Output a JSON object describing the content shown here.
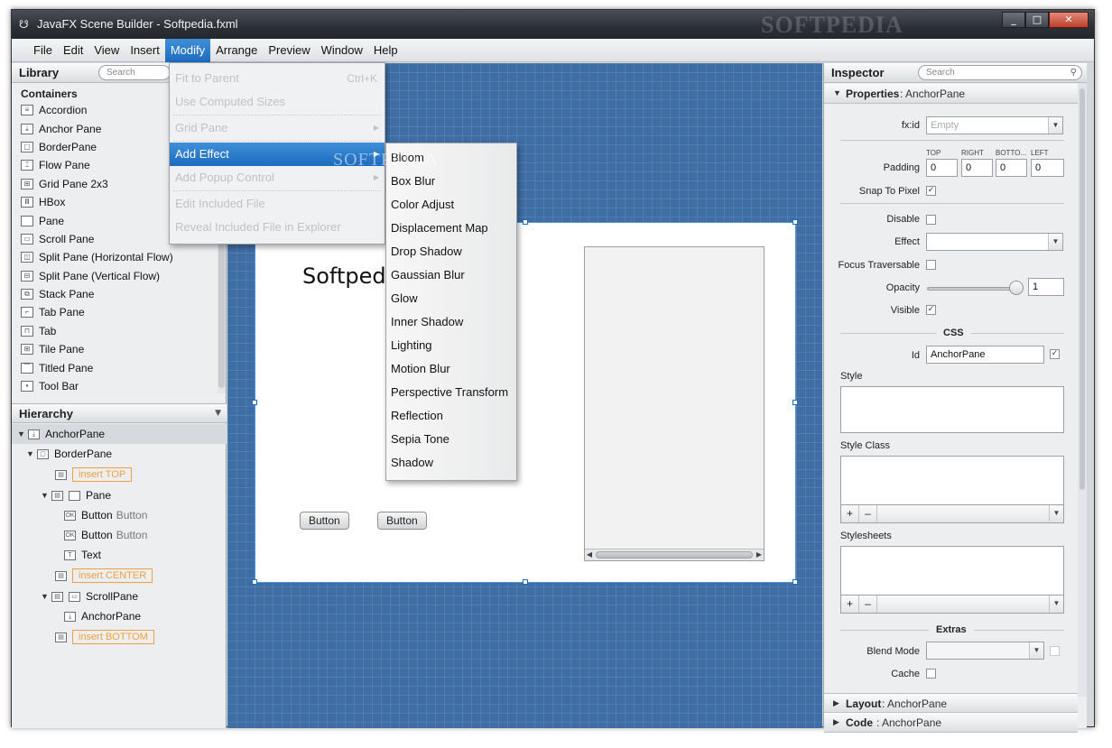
{
  "window": {
    "title": "JavaFX Scene Builder - Softpedia.fxml",
    "watermark": "SOFTPEDIA",
    "controls": [
      "_",
      "□",
      "✕"
    ]
  },
  "menubar": [
    "File",
    "Edit",
    "View",
    "Insert",
    "Modify",
    "Arrange",
    "Preview",
    "Window",
    "Help"
  ],
  "modify_menu": [
    {
      "label": "Fit to Parent",
      "accel": "Ctrl+K",
      "enabled": false
    },
    {
      "label": "Use Computed Sizes",
      "enabled": false
    },
    {
      "label": "Grid Pane",
      "enabled": false,
      "submenu": true
    },
    {
      "label": "Add Effect",
      "enabled": true,
      "submenu": true,
      "highlighted": true
    },
    {
      "label": "Add Popup Control",
      "enabled": false,
      "submenu": true
    },
    {
      "label": "Edit Included File",
      "enabled": false
    },
    {
      "label": "Reveal Included File in Explorer",
      "enabled": false
    }
  ],
  "effects_menu": [
    "Bloom",
    "Box Blur",
    "Color Adjust",
    "Displacement Map",
    "Drop Shadow",
    "Gaussian Blur",
    "Glow",
    "Inner Shadow",
    "Lighting",
    "Motion Blur",
    "Perspective Transform",
    "Reflection",
    "Sepia Tone",
    "Shadow"
  ],
  "library": {
    "title": "Library",
    "search_placeholder": "Search",
    "category": "Containers",
    "items": [
      "Accordion",
      "Anchor Pane",
      "BorderPane",
      "Flow Pane",
      "Grid Pane 2x3",
      "HBox",
      "Pane",
      "Scroll Pane",
      "Split Pane (Horizontal Flow)",
      "Split Pane (Vertical Flow)",
      "Stack Pane",
      "Tab Pane",
      "Tab",
      "Tile Pane",
      "Titled Pane",
      "Tool Bar"
    ]
  },
  "hierarchy": {
    "title": "Hierarchy",
    "rows": [
      {
        "label": "AnchorPane",
        "type": ""
      },
      {
        "label": "BorderPane",
        "type": ""
      },
      {
        "label": "insert TOP",
        "type": ""
      },
      {
        "label": "Pane",
        "type": ""
      },
      {
        "label": "Button",
        "type": "Button"
      },
      {
        "label": "Button",
        "type": "Button"
      },
      {
        "label": "Text",
        "type": ""
      },
      {
        "label": "insert CENTER",
        "type": ""
      },
      {
        "label": "ScrollPane",
        "type": ""
      },
      {
        "label": "AnchorPane",
        "type": ""
      },
      {
        "label": "insert BOTTOM",
        "type": ""
      }
    ]
  },
  "canvas": {
    "text": "Softpedia",
    "button1": "Button",
    "button2": "Button",
    "watermark": "SOFTPEDIA"
  },
  "inspector": {
    "title": "Inspector",
    "search_placeholder": "Search",
    "properties_label": "Properties",
    "properties_value": ": AnchorPane",
    "fxid_label": "fx:id",
    "fxid_placeholder": "Empty",
    "padding_label": "Padding",
    "padding_headers": [
      "TOP",
      "RIGHT",
      "BOTTO...",
      "LEFT"
    ],
    "padding_values": [
      "0",
      "0",
      "0",
      "0"
    ],
    "snap_label": "Snap To Pixel",
    "disable_label": "Disable",
    "effect_label": "Effect",
    "focus_label": "Focus Traversable",
    "opacity_label": "Opacity",
    "opacity_value": 1,
    "visible_label": "Visible",
    "css_label": "CSS",
    "id_label": "Id",
    "id_value": "AnchorPane",
    "style_label": "Style",
    "style_class_label": "Style Class",
    "stylesheets_label": "Stylesheets",
    "extras_label": "Extras",
    "blend_label": "Blend Mode",
    "cache_label": "Cache",
    "layout_label": "Layout",
    "layout_value": ": AnchorPane",
    "code_label": "Code",
    "code_value": ": AnchorPane",
    "plus": "+",
    "minus": "–"
  }
}
